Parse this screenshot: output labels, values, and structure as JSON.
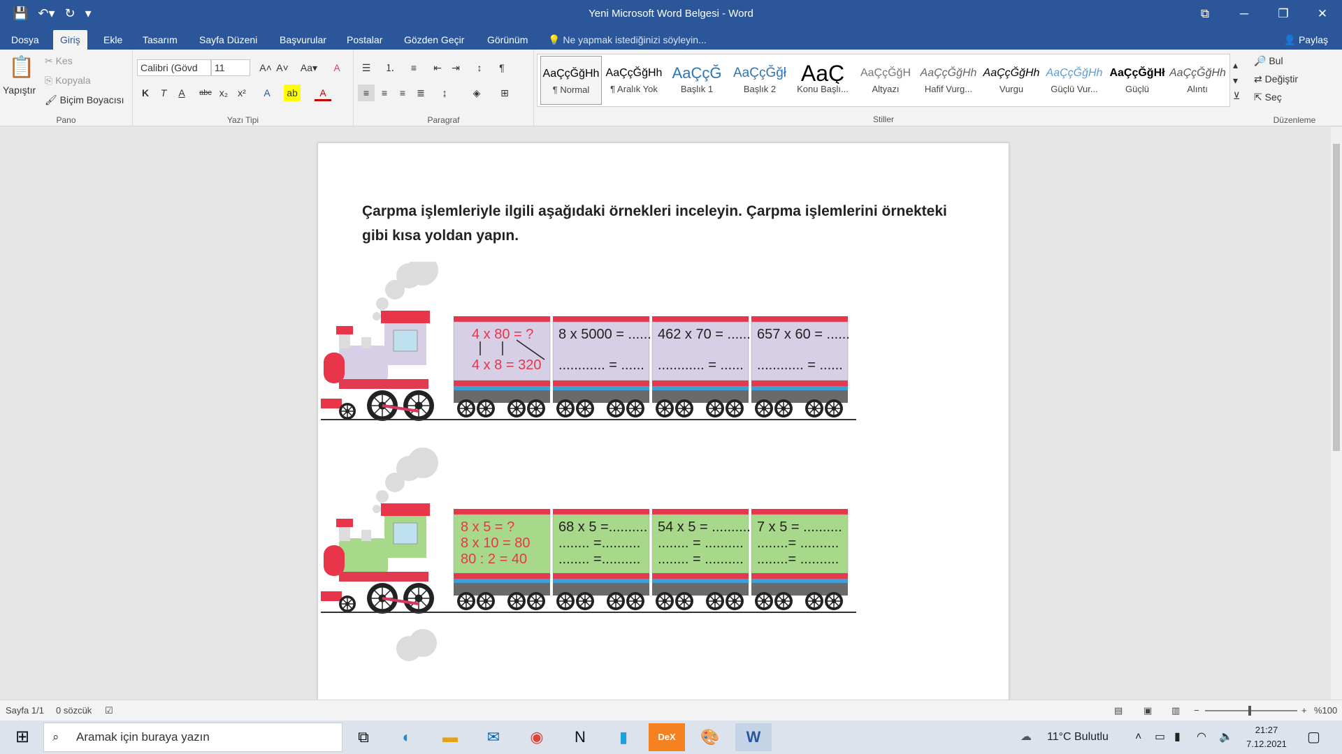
{
  "window": {
    "title": "Yeni Microsoft Word Belgesi - Word"
  },
  "qat": {
    "save_icon": "save-icon",
    "undo_icon": "undo-icon",
    "redo_icon": "redo-icon",
    "customize_icon": "chevron-down-icon"
  },
  "tabs": [
    {
      "label": "Dosya"
    },
    {
      "label": "Giriş"
    },
    {
      "label": "Ekle"
    },
    {
      "label": "Tasarım"
    },
    {
      "label": "Sayfa Düzeni"
    },
    {
      "label": "Başvurular"
    },
    {
      "label": "Postalar"
    },
    {
      "label": "Gözden Geçir"
    },
    {
      "label": "Görünüm"
    }
  ],
  "tellme": "Ne yapmak istediğinizi söyleyin...",
  "share": "Paylaş",
  "clipboard": {
    "paste": "Yapıştır",
    "cut": "Kes",
    "copy": "Kopyala",
    "painter": "Biçim Boyacısı",
    "label": "Pano"
  },
  "font": {
    "name": "Calibri (Gövd",
    "size": "11",
    "label": "Yazı Tipi",
    "bold": "K",
    "italic": "T",
    "underline": "A"
  },
  "paragraph": {
    "label": "Paragraf"
  },
  "styles": {
    "label": "Stiller",
    "items": [
      {
        "preview": "AaÇçĞğHh",
        "name": "¶ Normal"
      },
      {
        "preview": "AaÇçĞğHh",
        "name": "¶ Aralık Yok"
      },
      {
        "preview": "AaÇçĞ",
        "name": "Başlık 1"
      },
      {
        "preview": "AaÇçĞğł",
        "name": "Başlık 2"
      },
      {
        "preview": "AaÇ",
        "name": "Konu Başlı..."
      },
      {
        "preview": "AaÇçĞğH",
        "name": "Altyazı"
      },
      {
        "preview": "AaÇçĞğHh",
        "name": "Hafif Vurg..."
      },
      {
        "preview": "AaÇçĞğHh",
        "name": "Vurgu"
      },
      {
        "preview": "AaÇçĞğHh",
        "name": "Güçlü Vur..."
      },
      {
        "preview": "AaÇçĞğHł",
        "name": "Güçlü"
      },
      {
        "preview": "AaÇçĞğHh",
        "name": "Alıntı"
      }
    ]
  },
  "editing": {
    "find": "Bul",
    "replace": "Değiştir",
    "select": "Seç",
    "label": "Düzenleme"
  },
  "document": {
    "instruction": "Çarpma işlemleriyle ilgili aşağıdaki örnekleri inceleyin. Çarpma işlemlerini örnekteki gibi kısa yoldan yapın.",
    "train1": {
      "example": [
        "4 x 80 = ?",
        "4 x 8 = 320"
      ],
      "cars": [
        [
          "8 x 5000 = ......",
          "............ = ......"
        ],
        [
          "462 x 70 = ......",
          "............ = ......"
        ],
        [
          "657 x 60 = ......",
          "............ = ......"
        ]
      ],
      "colors": {
        "car": "#d6cfe6",
        "accent": "#e8354a"
      }
    },
    "train2": {
      "example": [
        "8 x 5 = ?",
        "8 x 10 = 80",
        "80 : 2 = 40"
      ],
      "cars": [
        [
          "68 x 5 =..........",
          "........ =..........",
          "........ =.........."
        ],
        [
          "54 x 5 = ..........",
          "........ = ..........",
          "........ = .........."
        ],
        [
          "7 x 5 = ..........",
          "........= ..........",
          "........= .........."
        ]
      ],
      "colors": {
        "car": "#a8d98a",
        "accent": "#e8354a"
      }
    }
  },
  "status": {
    "page": "Sayfa 1/1",
    "words": "0 sözcük",
    "zoom": "%100"
  },
  "taskbar": {
    "search": "Aramak için buraya yazın",
    "weather": "11°C  Bulutlu",
    "time": "21:27",
    "date": "7.12.2021"
  }
}
